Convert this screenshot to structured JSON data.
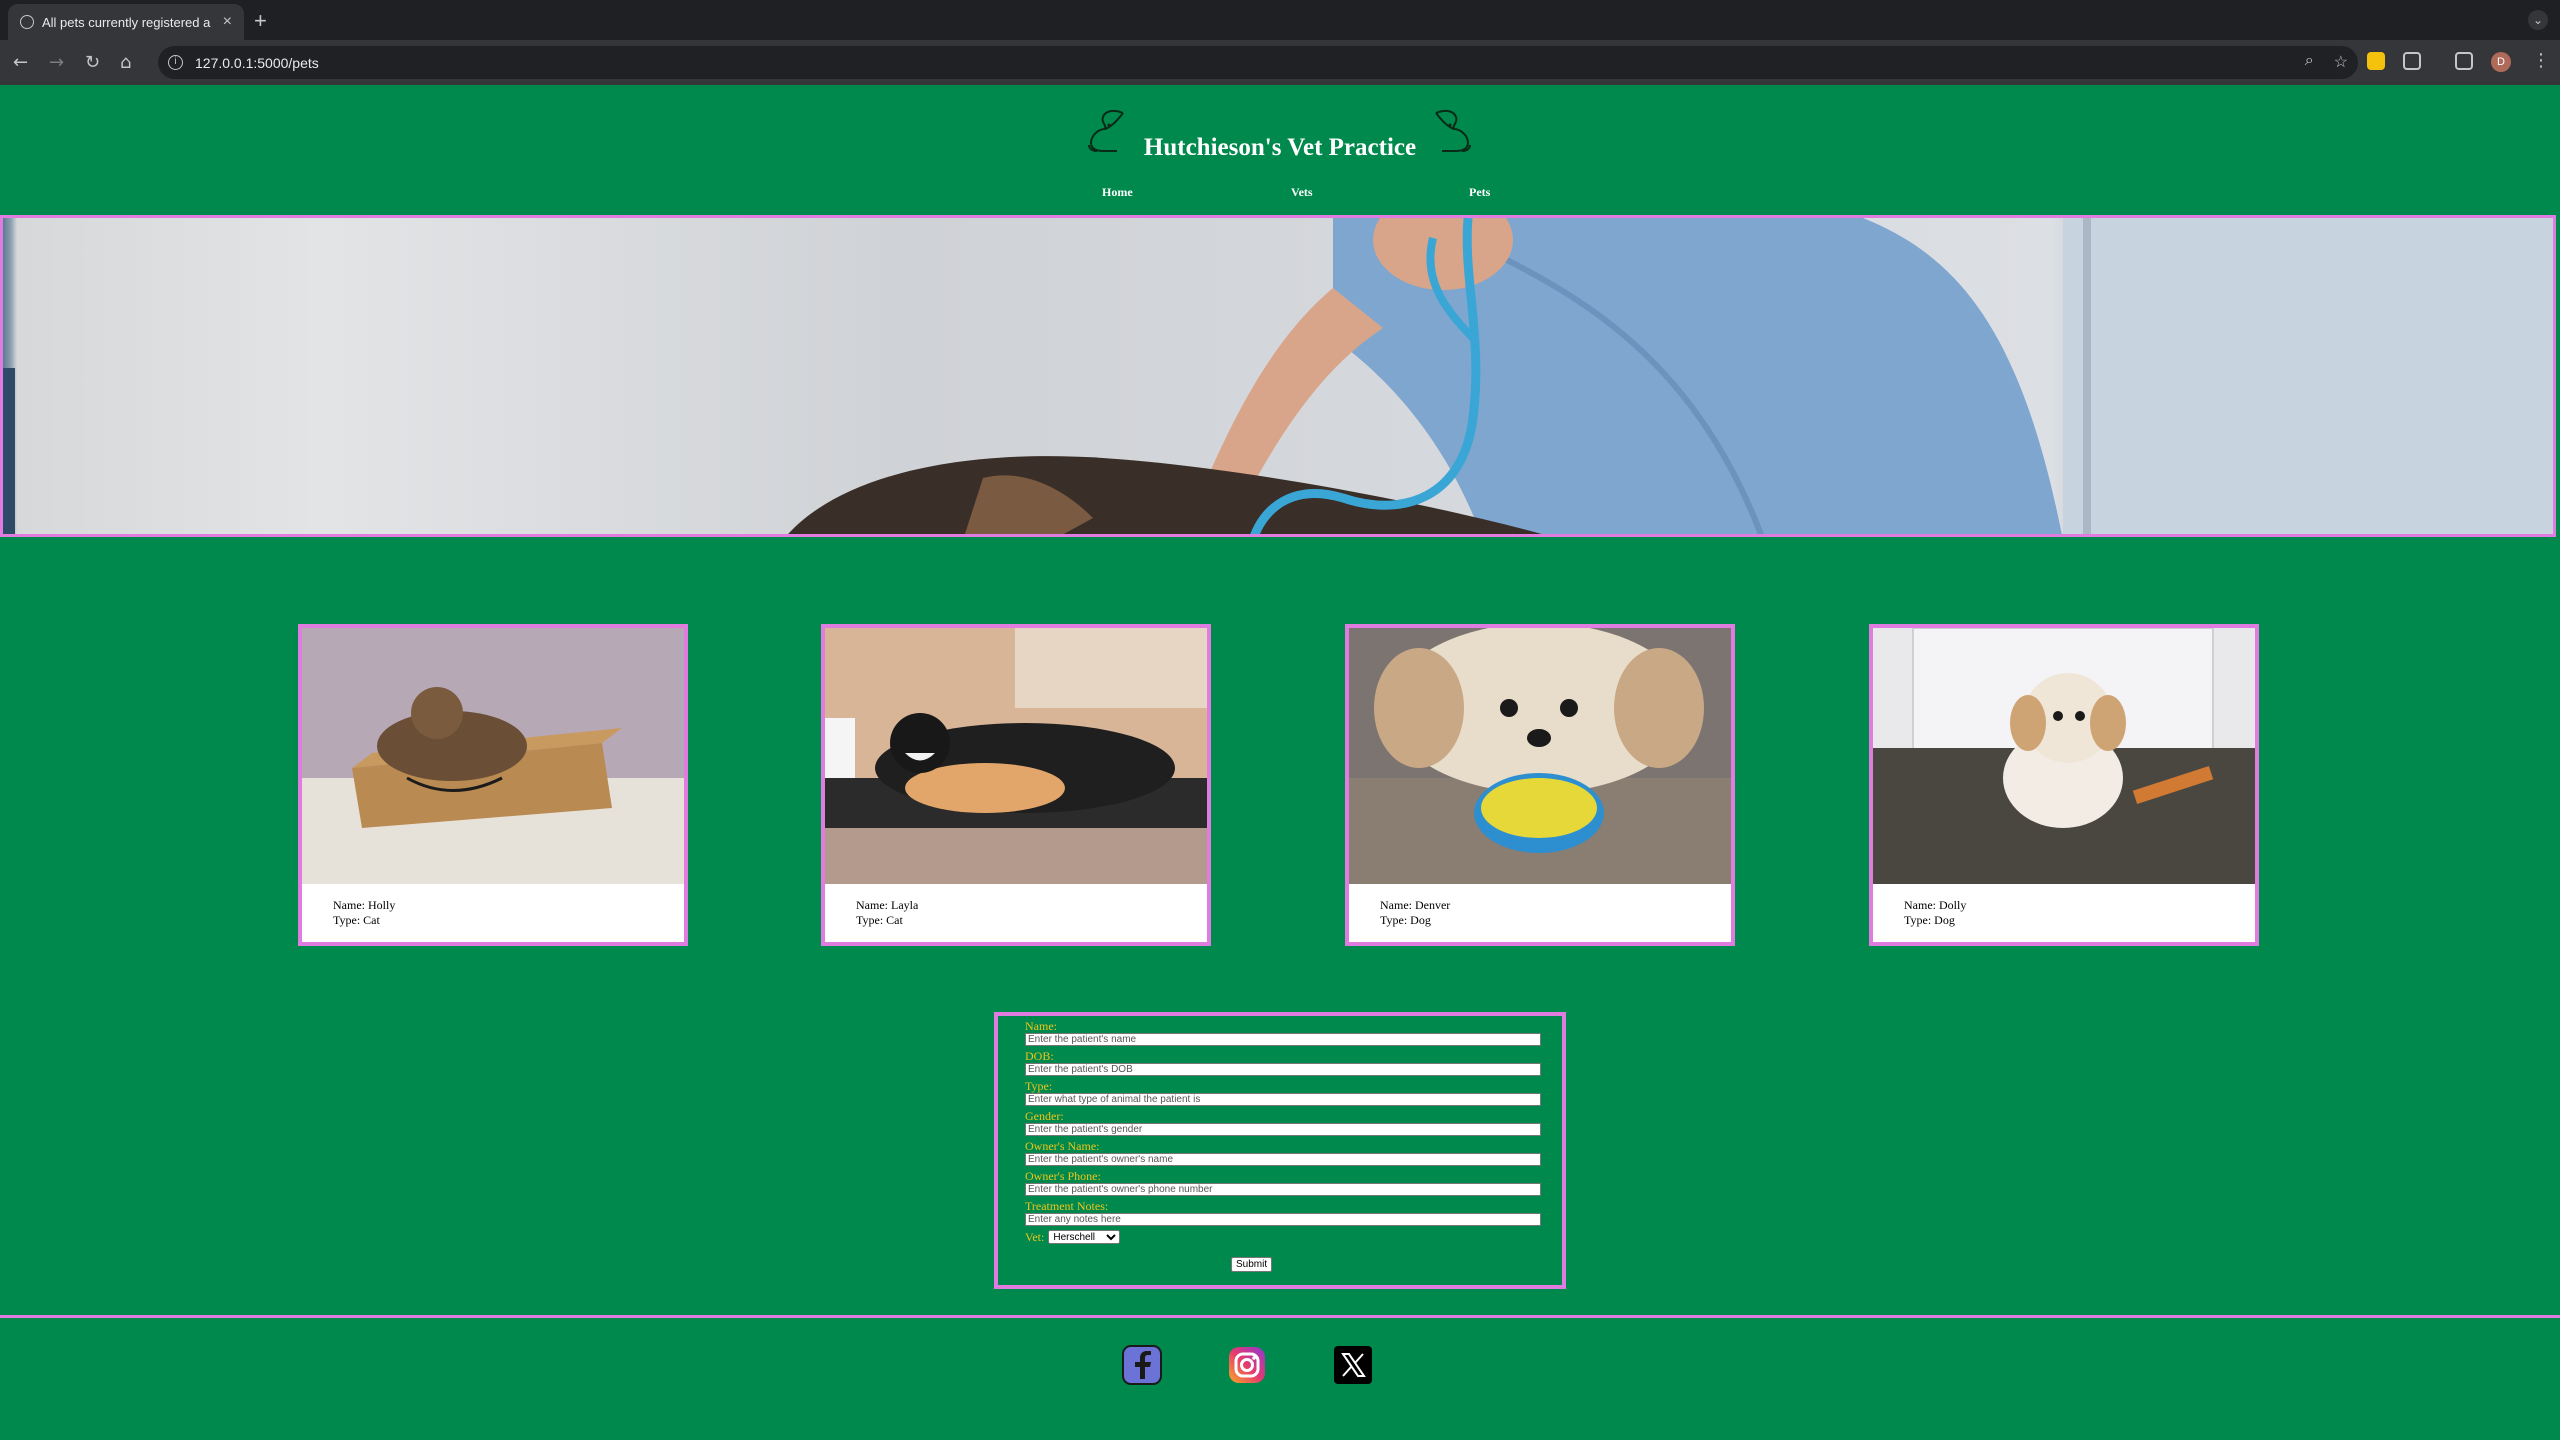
{
  "browser": {
    "tab_title": "All pets currently registered a",
    "tab_close": "×",
    "new_tab": "+",
    "url": "127.0.0.1:5000/pets",
    "profile_initial": "D",
    "tabs_menu": "⌄"
  },
  "header": {
    "title": "Hutchieson's Vet Practice",
    "nav": [
      "Home",
      "Vets",
      "Pets"
    ]
  },
  "pets": [
    {
      "name_line": "Name: Holly",
      "type_line": "Type: Cat",
      "photo": "cat-in-box-photo"
    },
    {
      "name_line": "Name: Layla",
      "type_line": "Type: Cat",
      "photo": "black-white-cat-photo"
    },
    {
      "name_line": "Name: Denver",
      "type_line": "Type: Dog",
      "photo": "dog-with-ball-photo"
    },
    {
      "name_line": "Name: Dolly",
      "type_line": "Type: Dog",
      "photo": "small-dog-photo"
    }
  ],
  "form": {
    "fields": [
      {
        "label": "Name:",
        "placeholder": "Enter the patient's name"
      },
      {
        "label": "DOB:",
        "placeholder": "Enter the patient's DOB"
      },
      {
        "label": "Type:",
        "placeholder": "Enter what type of animal the patient is"
      },
      {
        "label": "Gender:",
        "placeholder": "Enter the patient's gender"
      },
      {
        "label": "Owner's Name:",
        "placeholder": "Enter the patient's owner's name"
      },
      {
        "label": "Owner's Phone:",
        "placeholder": "Enter the patient's owner's phone number"
      },
      {
        "label": "Treatment Notes:",
        "placeholder": "Enter any notes here"
      }
    ],
    "vet_label": "Vet:",
    "vet_selected": "Herschell",
    "submit_label": "Submit"
  },
  "footer": {
    "social_icons": [
      "facebook-icon",
      "instagram-icon",
      "x-icon"
    ]
  },
  "colors": {
    "page_bg": "#00894d",
    "accent_border": "#e07be0",
    "label_yellow": "#f0c419"
  }
}
